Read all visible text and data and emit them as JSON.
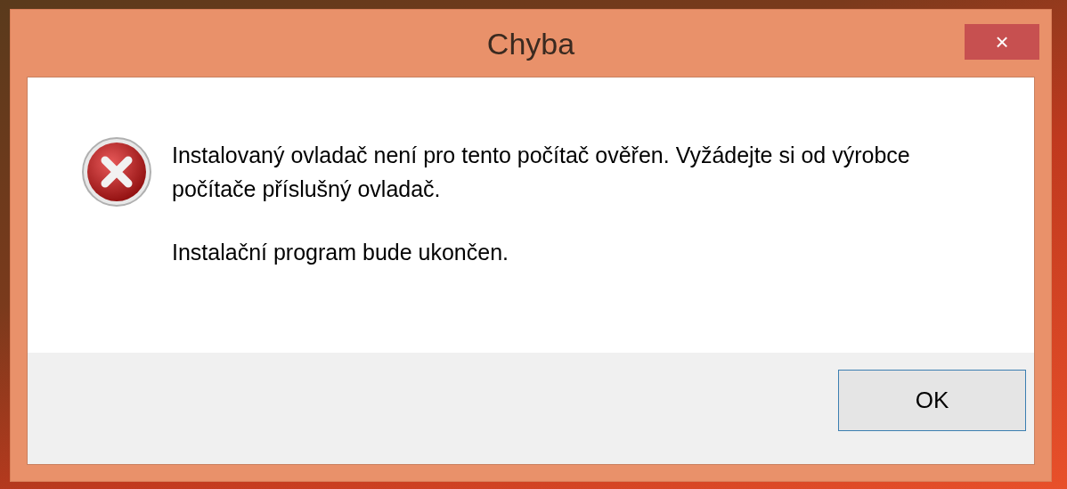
{
  "window": {
    "title": "Chyba",
    "close": "×"
  },
  "message": "Instalovaný ovladač není pro tento počítač ověřen. Vyžádejte si od výrobce počítače příslušný ovladač.",
  "note": "Instalační program bude ukončen.",
  "buttons": [
    {
      "label": "OK"
    }
  ]
}
